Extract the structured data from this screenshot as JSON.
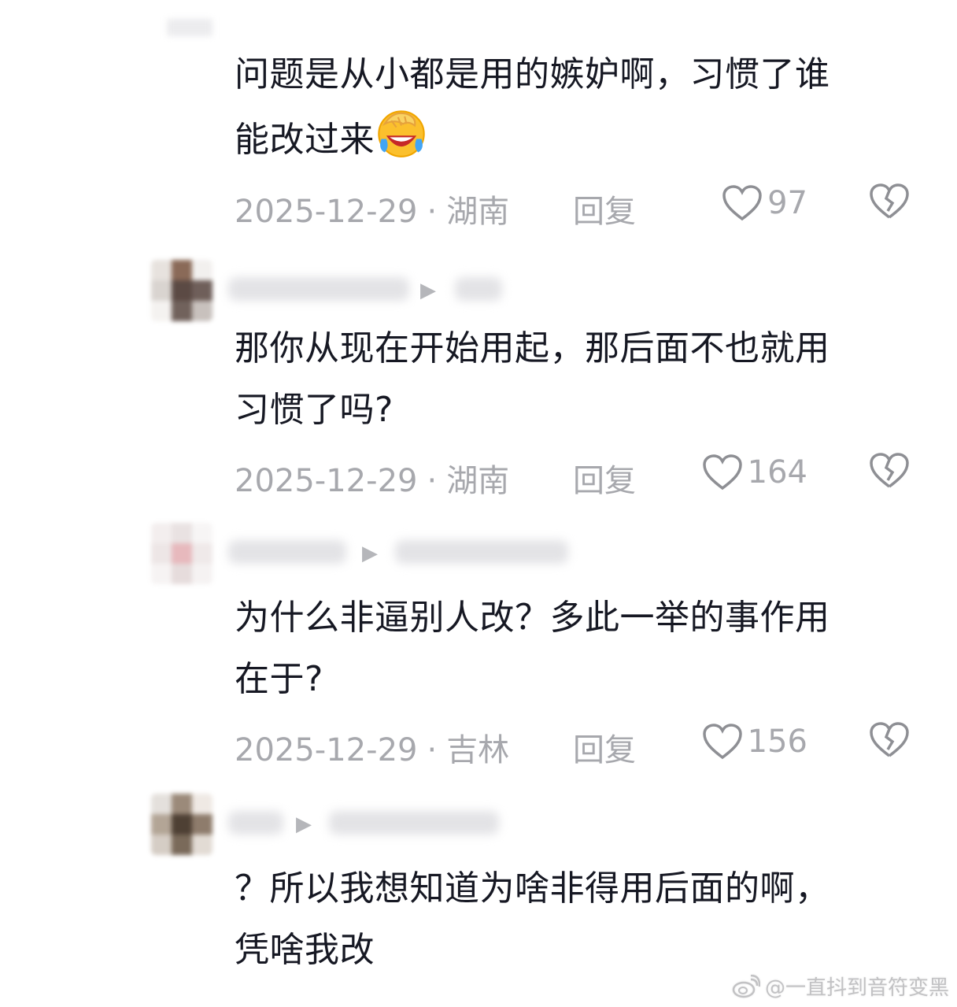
{
  "comments": [
    {
      "text_line1": "问题是从小都是用的嫉妒啊，习惯了谁",
      "text_line2": "能改过来",
      "has_emoji": true,
      "emoji_name": "laugh-cry-emoji",
      "date": "2025-12-29",
      "separator": "·",
      "location": "湖南",
      "reply_label": "回复",
      "likes": "97"
    },
    {
      "text_line1": "那你从现在开始用起，那后面不也就用",
      "text_line2": "习惯了吗?",
      "date": "2025-12-29",
      "separator": "·",
      "location": "湖南",
      "reply_label": "回复",
      "likes": "164"
    },
    {
      "text_line1": "为什么非逼别人改？多此一举的事作用",
      "text_line2": "在于?",
      "date": "2025-12-29",
      "separator": "·",
      "location": "吉林",
      "reply_label": "回复",
      "likes": "156"
    },
    {
      "text_line1": "？所以我想知道为啥非得用后面的啊，",
      "text_line2": "凭啥我改"
    }
  ],
  "watermark": {
    "text": "@一直抖到音符变黑",
    "logo": "weibo-logo-icon"
  },
  "colors": {
    "text": "#161823",
    "meta": "#a7a8ad",
    "background": "#ffffff"
  }
}
